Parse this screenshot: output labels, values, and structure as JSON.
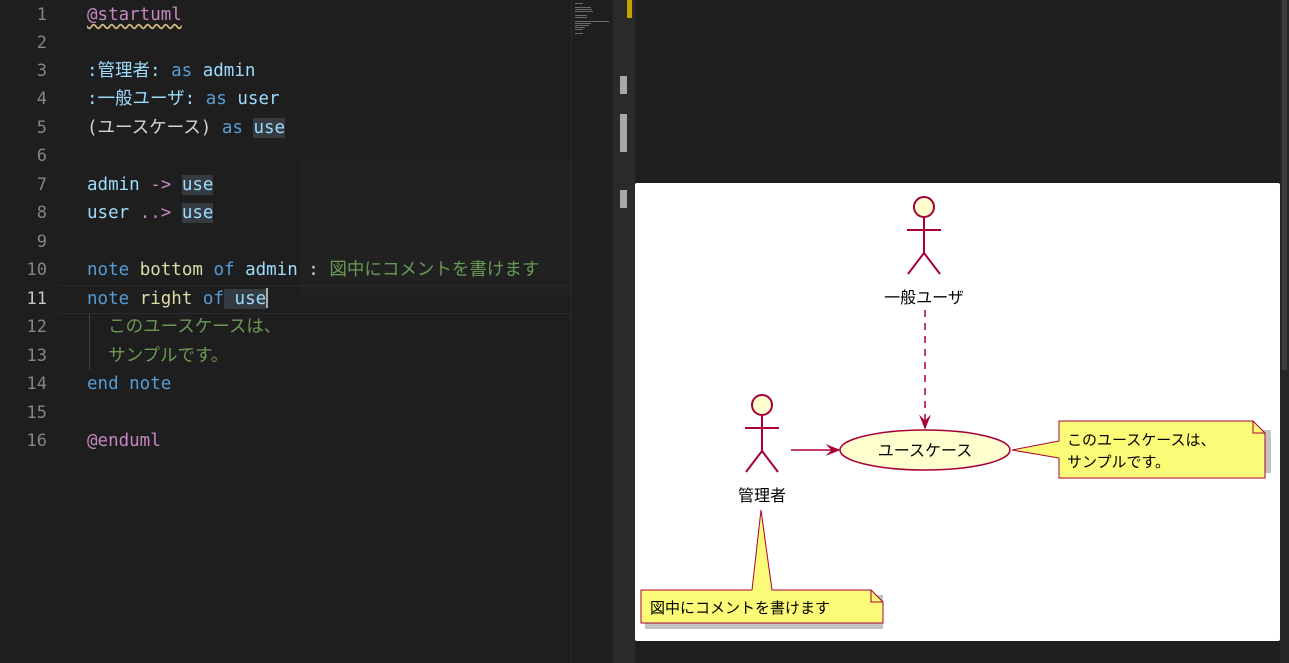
{
  "editor": {
    "lines": [
      {
        "num": "1",
        "t1": "@startuml"
      },
      {
        "num": "2"
      },
      {
        "num": "3",
        "t1": ":管理者:",
        "t2": " as ",
        "t3": "admin"
      },
      {
        "num": "4",
        "t1": ":一般ユーザ:",
        "t2": " as ",
        "t3": "user"
      },
      {
        "num": "5",
        "t1": "(ユースケース)",
        "t2": " as ",
        "t3": "use"
      },
      {
        "num": "6"
      },
      {
        "num": "7",
        "t1": "admin",
        "t2": " -> ",
        "t3": "use"
      },
      {
        "num": "8",
        "t1": "user",
        "t2": " ..> ",
        "t3": "use"
      },
      {
        "num": "9"
      },
      {
        "num": "10",
        "t1": "note",
        "t2": " bottom ",
        "t3": "of",
        "t4": " admin ",
        "t5": ": ",
        "t6": "図中にコメントを書けます"
      },
      {
        "num": "11",
        "t1": "note",
        "t2": " right ",
        "t3": "of",
        "t4": " use"
      },
      {
        "num": "12",
        "t1": "  このユースケースは、"
      },
      {
        "num": "13",
        "t1": "  サンプルです。"
      },
      {
        "num": "14",
        "t1": "end",
        "t2": " note"
      },
      {
        "num": "15"
      },
      {
        "num": "16",
        "t1": "@enduml"
      }
    ]
  },
  "diagram": {
    "actor_user": "一般ユーザ",
    "actor_admin": "管理者",
    "usecase": "ユースケース",
    "note_right_line1": "このユースケースは、",
    "note_right_line2": "サンプルです。",
    "note_bottom": "図中にコメントを書けます"
  },
  "colors": {
    "actor_fill": "#FEFECE",
    "actor_stroke": "#A80036",
    "note_fill": "#FBFB77"
  }
}
